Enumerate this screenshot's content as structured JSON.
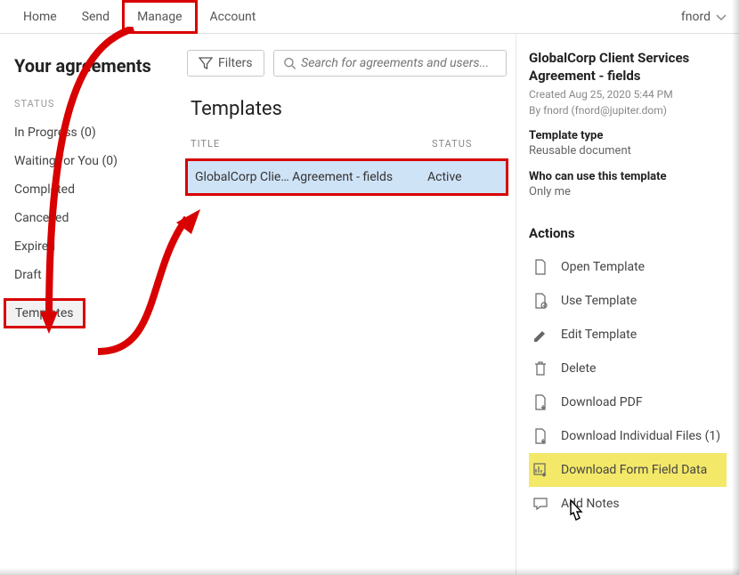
{
  "nav": {
    "home": "Home",
    "send": "Send",
    "manage": "Manage",
    "account": "Account"
  },
  "user": {
    "name": "fnord"
  },
  "page": {
    "title": "Your agreements",
    "status_header": "STATUS"
  },
  "statuses": {
    "in_progress": "In Progress (0)",
    "waiting": "Waiting for You (0)",
    "completed": "Completed",
    "cancelled": "Cancelled",
    "expired": "Expired",
    "draft": "Draft",
    "templates": "Templates"
  },
  "toolbar": {
    "filters": "Filters"
  },
  "search": {
    "placeholder": "Search for agreements and users..."
  },
  "mid": {
    "heading": "Templates",
    "col_title": "TITLE",
    "col_status": "STATUS",
    "row_title": "GlobalCorp Clie…  Agreement - fields",
    "row_status": "Active"
  },
  "detail": {
    "title": "GlobalCorp Client Services Agreement - fields",
    "created": "Created Aug 25, 2020 5:44 PM",
    "by": "By fnord (fnord@jupiter.dom)",
    "type_label": "Template type",
    "type_value": "Reusable document",
    "who_label": "Who can use this template",
    "who_value": "Only me",
    "actions_heading": "Actions"
  },
  "actions": {
    "open": "Open Template",
    "use": "Use Template",
    "edit": "Edit Template",
    "delete": "Delete",
    "download_pdf": "Download PDF",
    "download_files": "Download Individual Files (1)",
    "download_form": "Download Form Field Data",
    "notes": "Add Notes"
  }
}
